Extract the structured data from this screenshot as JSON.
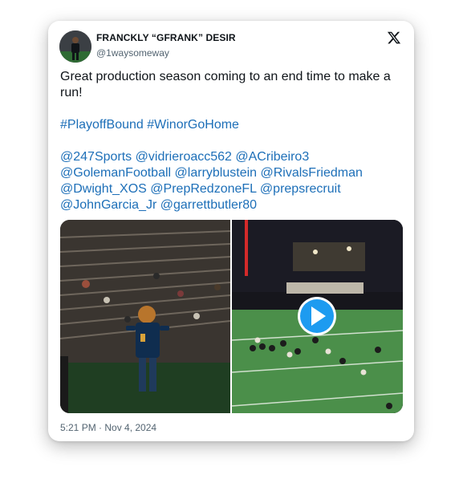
{
  "tweet": {
    "author_name": "FRANCKLY “GFRANK” DESIR",
    "author_handle": "@1waysomeway",
    "text_line": "Great production season coming to an end time to make a run!",
    "hashtags": [
      "#PlayoffBound",
      "#WinorGoHome"
    ],
    "mentions": [
      "@247Sports",
      "@vidrieroacc562",
      "@ACribeiro3",
      "@GolemanFootball",
      "@larryblustein",
      "@RivalsFriedman",
      "@Dwight_XOS",
      "@PrepRedzoneFL",
      "@prepsrecruit",
      "@JohnGarcia_Jr",
      "@garrettbutler80"
    ],
    "timestamp": "5:21 PM · Nov 4, 2024"
  },
  "icons": {
    "platform": "x-logo-icon",
    "video": "play-icon"
  },
  "colors": {
    "link": "#1d6fb8",
    "play_button": "#1d9bf0",
    "text": "#0f1419",
    "muted": "#536471"
  }
}
